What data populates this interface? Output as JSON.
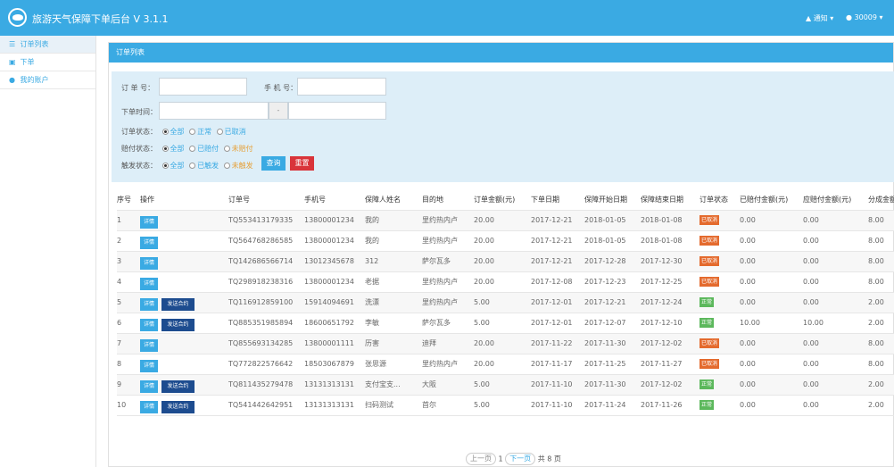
{
  "header": {
    "title": "旅游天气保障下单后台 V 3.1.1",
    "notify_label": "通知",
    "user_label": "30009",
    "bg_color": "#3aaae3"
  },
  "sidebar": {
    "items": [
      {
        "label": "订单列表",
        "icon": "list-icon",
        "active": true
      },
      {
        "label": "下单",
        "icon": "cart-icon",
        "active": false
      },
      {
        "label": "我的账户",
        "icon": "user-icon",
        "active": false
      }
    ]
  },
  "panel": {
    "title": "订单列表"
  },
  "filters": {
    "order_no_label": "订 单 号：",
    "order_no_value": "",
    "phone_label": "手 机 号：",
    "phone_value": "",
    "order_time_label": "下单时间：",
    "date_separator": "-",
    "order_status_label": "订单状态：",
    "order_status_options": [
      "全部",
      "正常",
      "已取消"
    ],
    "order_status_selected": "全部",
    "pay_status_label": "赔付状态：",
    "pay_status_options": [
      "全部",
      "已赔付",
      "未赔付"
    ],
    "pay_status_selected": "全部",
    "trigger_status_label": "触发状态：",
    "trigger_status_options": [
      "全部",
      "已触发",
      "未触发"
    ],
    "trigger_status_selected": "全部",
    "search_label": "查询",
    "reset_label": "重置"
  },
  "table": {
    "headers": [
      "序号",
      "操作",
      "订单号",
      "手机号",
      "保障人姓名",
      "目的地",
      "订单金额(元)",
      "下单日期",
      "保障开始日期",
      "保障结束日期",
      "订单状态",
      "已赔付金额(元)",
      "应赔付金额(元)",
      "分成金额"
    ],
    "detail_label": "详情",
    "send_label": "发送合约",
    "rows": [
      {
        "idx": "1",
        "send": false,
        "order_no": "TQ553413179335",
        "phone": "13800001234",
        "name": "我的",
        "dest": "里约热内卢",
        "amount": "20.00",
        "order_date": "2017-12-21",
        "start": "2018-01-05",
        "end": "2018-01-08",
        "status": "已取消",
        "status_type": "cancel",
        "paid": "0.00",
        "payable": "0.00",
        "share": "8.00"
      },
      {
        "idx": "2",
        "send": false,
        "order_no": "TQ564768286585",
        "phone": "13800001234",
        "name": "我的",
        "dest": "里约热内卢",
        "amount": "20.00",
        "order_date": "2017-12-21",
        "start": "2018-01-05",
        "end": "2018-01-08",
        "status": "已取消",
        "status_type": "cancel",
        "paid": "0.00",
        "payable": "0.00",
        "share": "8.00"
      },
      {
        "idx": "3",
        "send": false,
        "order_no": "TQ142686566714",
        "phone": "13012345678",
        "name": "312",
        "dest": "萨尔瓦多",
        "amount": "20.00",
        "order_date": "2017-12-21",
        "start": "2017-12-28",
        "end": "2017-12-30",
        "status": "已取消",
        "status_type": "cancel",
        "paid": "0.00",
        "payable": "0.00",
        "share": "8.00"
      },
      {
        "idx": "4",
        "send": false,
        "order_no": "TQ298918238316",
        "phone": "13800001234",
        "name": "老据",
        "dest": "里约热内卢",
        "amount": "20.00",
        "order_date": "2017-12-08",
        "start": "2017-12-23",
        "end": "2017-12-25",
        "status": "已取消",
        "status_type": "cancel",
        "paid": "0.00",
        "payable": "0.00",
        "share": "8.00"
      },
      {
        "idx": "5",
        "send": true,
        "order_no": "TQ116912859100",
        "phone": "15914094691",
        "name": "洗漂",
        "dest": "里约热内卢",
        "amount": "5.00",
        "order_date": "2017-12-01",
        "start": "2017-12-21",
        "end": "2017-12-24",
        "status": "正常",
        "status_type": "normal",
        "paid": "0.00",
        "payable": "0.00",
        "share": "2.00"
      },
      {
        "idx": "6",
        "send": true,
        "order_no": "TQ885351985894",
        "phone": "18600651792",
        "name": "李敏",
        "dest": "萨尔瓦多",
        "amount": "5.00",
        "order_date": "2017-12-01",
        "start": "2017-12-07",
        "end": "2017-12-10",
        "status": "正常",
        "status_type": "normal",
        "paid": "10.00",
        "payable": "10.00",
        "share": "2.00"
      },
      {
        "idx": "7",
        "send": false,
        "order_no": "TQ855693134285",
        "phone": "13800001111",
        "name": "历害",
        "dest": "迪拜",
        "amount": "20.00",
        "order_date": "2017-11-22",
        "start": "2017-11-30",
        "end": "2017-12-02",
        "status": "已取消",
        "status_type": "cancel",
        "paid": "0.00",
        "payable": "0.00",
        "share": "8.00"
      },
      {
        "idx": "8",
        "send": false,
        "order_no": "TQ772822576642",
        "phone": "18503067879",
        "name": "张思源",
        "dest": "里约热内卢",
        "amount": "20.00",
        "order_date": "2017-11-17",
        "start": "2017-11-25",
        "end": "2017-11-27",
        "status": "已取消",
        "status_type": "cancel",
        "paid": "0.00",
        "payable": "0.00",
        "share": "8.00"
      },
      {
        "idx": "9",
        "send": true,
        "order_no": "TQ811435279478",
        "phone": "13131313131",
        "name": "支付宝支...",
        "dest": "大阪",
        "amount": "5.00",
        "order_date": "2017-11-10",
        "start": "2017-11-30",
        "end": "2017-12-02",
        "status": "正常",
        "status_type": "normal",
        "paid": "0.00",
        "payable": "0.00",
        "share": "2.00"
      },
      {
        "idx": "10",
        "send": true,
        "order_no": "TQ541442642951",
        "phone": "13131313131",
        "name": "扫码测试",
        "dest": "首尔",
        "amount": "5.00",
        "order_date": "2017-11-10",
        "start": "2017-11-24",
        "end": "2017-11-26",
        "status": "正常",
        "status_type": "normal",
        "paid": "0.00",
        "payable": "0.00",
        "share": "2.00"
      }
    ]
  },
  "pagination": {
    "prev_label": "上一页",
    "current_page": "1",
    "next_label": "下一页",
    "total_label": "共 8 页"
  }
}
